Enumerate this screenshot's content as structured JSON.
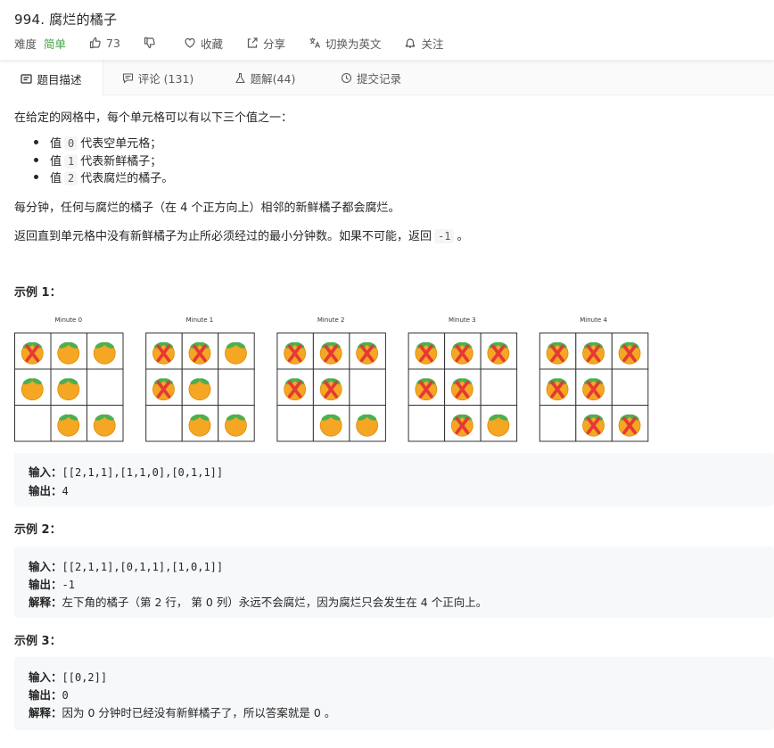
{
  "problem": {
    "title": "994. 腐烂的橘子",
    "difficulty_label": "难度",
    "difficulty": "简单",
    "likes": "73",
    "favorite": "收藏",
    "share": "分享",
    "switch_lang": "切换为英文",
    "follow": "关注"
  },
  "tabs": [
    {
      "label": "题目描述"
    },
    {
      "label": "评论 (131)"
    },
    {
      "label": "题解(44)"
    },
    {
      "label": "提交记录"
    }
  ],
  "description": {
    "intro": "在给定的网格中，每个单元格可以有以下三个值之一：",
    "items": [
      {
        "pre": "值",
        "code": "0",
        "post": "代表空单元格；"
      },
      {
        "pre": "值",
        "code": "1",
        "post": "代表新鲜橘子；"
      },
      {
        "pre": "值",
        "code": "2",
        "post": "代表腐烂的橘子。"
      }
    ],
    "para1": "每分钟，任何与腐烂的橘子（在 4 个正方向上）相邻的新鲜橘子都会腐烂。",
    "para2_pre": "返回直到单元格中没有新鲜橘子为止所必须经过的最小分钟数。如果不可能，返回",
    "para2_code": "-1",
    "para2_post": "。"
  },
  "figure": {
    "panels": [
      {
        "label": "Minute 0",
        "grid": [
          [
            2,
            1,
            1
          ],
          [
            1,
            1,
            0
          ],
          [
            0,
            1,
            1
          ]
        ]
      },
      {
        "label": "Minute 1",
        "grid": [
          [
            2,
            2,
            1
          ],
          [
            2,
            1,
            0
          ],
          [
            0,
            1,
            1
          ]
        ]
      },
      {
        "label": "Minute 2",
        "grid": [
          [
            2,
            2,
            2
          ],
          [
            2,
            2,
            0
          ],
          [
            0,
            1,
            1
          ]
        ]
      },
      {
        "label": "Minute 3",
        "grid": [
          [
            2,
            2,
            2
          ],
          [
            2,
            2,
            0
          ],
          [
            0,
            2,
            1
          ]
        ]
      },
      {
        "label": "Minute 4",
        "grid": [
          [
            2,
            2,
            2
          ],
          [
            2,
            2,
            0
          ],
          [
            0,
            2,
            2
          ]
        ]
      }
    ],
    "colors": {
      "orange": "#f5a623",
      "leaf": "#4caf50",
      "rot_mark": "#e53935",
      "grid_line": "#333333"
    }
  },
  "examples": [
    {
      "heading": "示例 1：",
      "input_label": "输入：",
      "input": "[[2,1,1],[1,1,0],[0,1,1]]",
      "output_label": "输出：",
      "output": "4"
    },
    {
      "heading": "示例 2：",
      "input_label": "输入：",
      "input": "[[2,1,1],[0,1,1],[1,0,1]]",
      "output_label": "输出：",
      "output": "-1",
      "explain_label": "解释：",
      "explain": "左下角的橘子（第 2 行， 第 0 列）永远不会腐烂，因为腐烂只会发生在 4 个正向上。"
    },
    {
      "heading": "示例 3：",
      "input_label": "输入：",
      "input": "[[0,2]]",
      "output_label": "输出：",
      "output": "0",
      "explain_label": "解释：",
      "explain": "因为 0 分钟时已经没有新鲜橘子了，所以答案就是 0 。"
    }
  ]
}
